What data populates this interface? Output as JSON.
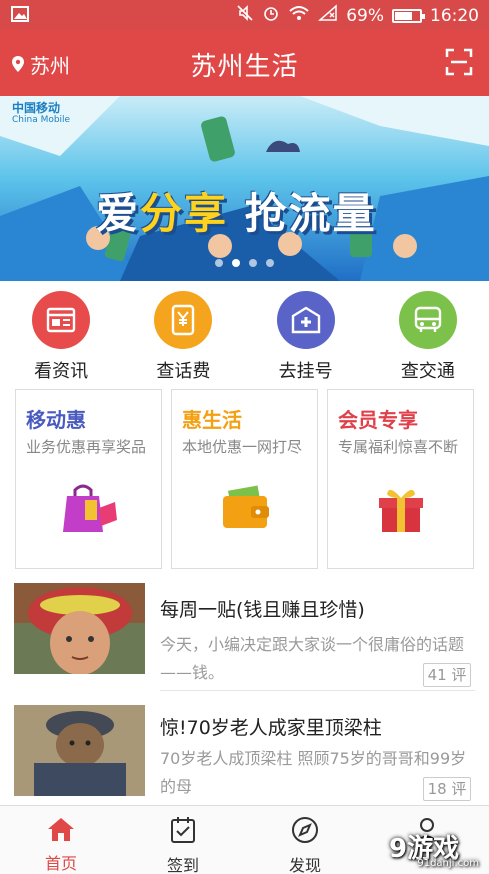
{
  "status_bar": {
    "battery": "69%",
    "time": "16:20",
    "battery_level": 0.69
  },
  "header": {
    "location": "苏州",
    "title": "苏州生活"
  },
  "banner": {
    "logo_cn": "中国移动",
    "logo_en": "China Mobile",
    "slogan_a": "爱",
    "slogan_b": "分享",
    "slogan_c": " 抢流量",
    "slides": 4,
    "active_slide": 1
  },
  "quick_actions": [
    {
      "label": "看资讯",
      "icon": "news-icon",
      "color": "#e84b4b"
    },
    {
      "label": "查话费",
      "icon": "phone-bill-icon",
      "color": "#f5a51d"
    },
    {
      "label": "去挂号",
      "icon": "hospital-icon",
      "color": "#5a64c8"
    },
    {
      "label": "查交通",
      "icon": "bus-icon",
      "color": "#7cc24a"
    }
  ],
  "cards": [
    {
      "title": "移动惠",
      "subtitle": "业务优惠再享奖品",
      "color": "#4a5bbf",
      "icon": "shopping-bag-icon"
    },
    {
      "title": "惠生活",
      "subtitle": "本地优惠一网打尽",
      "color": "#f3a113",
      "icon": "wallet-icon"
    },
    {
      "title": "会员专享",
      "subtitle": "专属福利惊喜不断",
      "color": "#e0404a",
      "icon": "gift-icon"
    }
  ],
  "articles": [
    {
      "title": "每周一贴(钱且赚且珍惜)",
      "desc": "今天，小编决定跟大家谈一个很庸俗的话题——钱。",
      "comments": "41 评"
    },
    {
      "title": "惊!70岁老人成家里顶梁柱",
      "desc": "70岁老人成顶梁柱 照顾75岁的哥哥和99岁的母",
      "comments": "18 评"
    }
  ],
  "nav": [
    {
      "label": "首页",
      "icon": "home-icon",
      "active": true
    },
    {
      "label": "签到",
      "icon": "checkin-icon",
      "active": false
    },
    {
      "label": "发现",
      "icon": "compass-icon",
      "active": false
    },
    {
      "label": "",
      "icon": "user-icon",
      "active": false
    }
  ],
  "watermark": {
    "text": "9游戏",
    "sub": "91danji.com"
  },
  "colors": {
    "brand": "#e04848",
    "status": "#d84a4a"
  }
}
